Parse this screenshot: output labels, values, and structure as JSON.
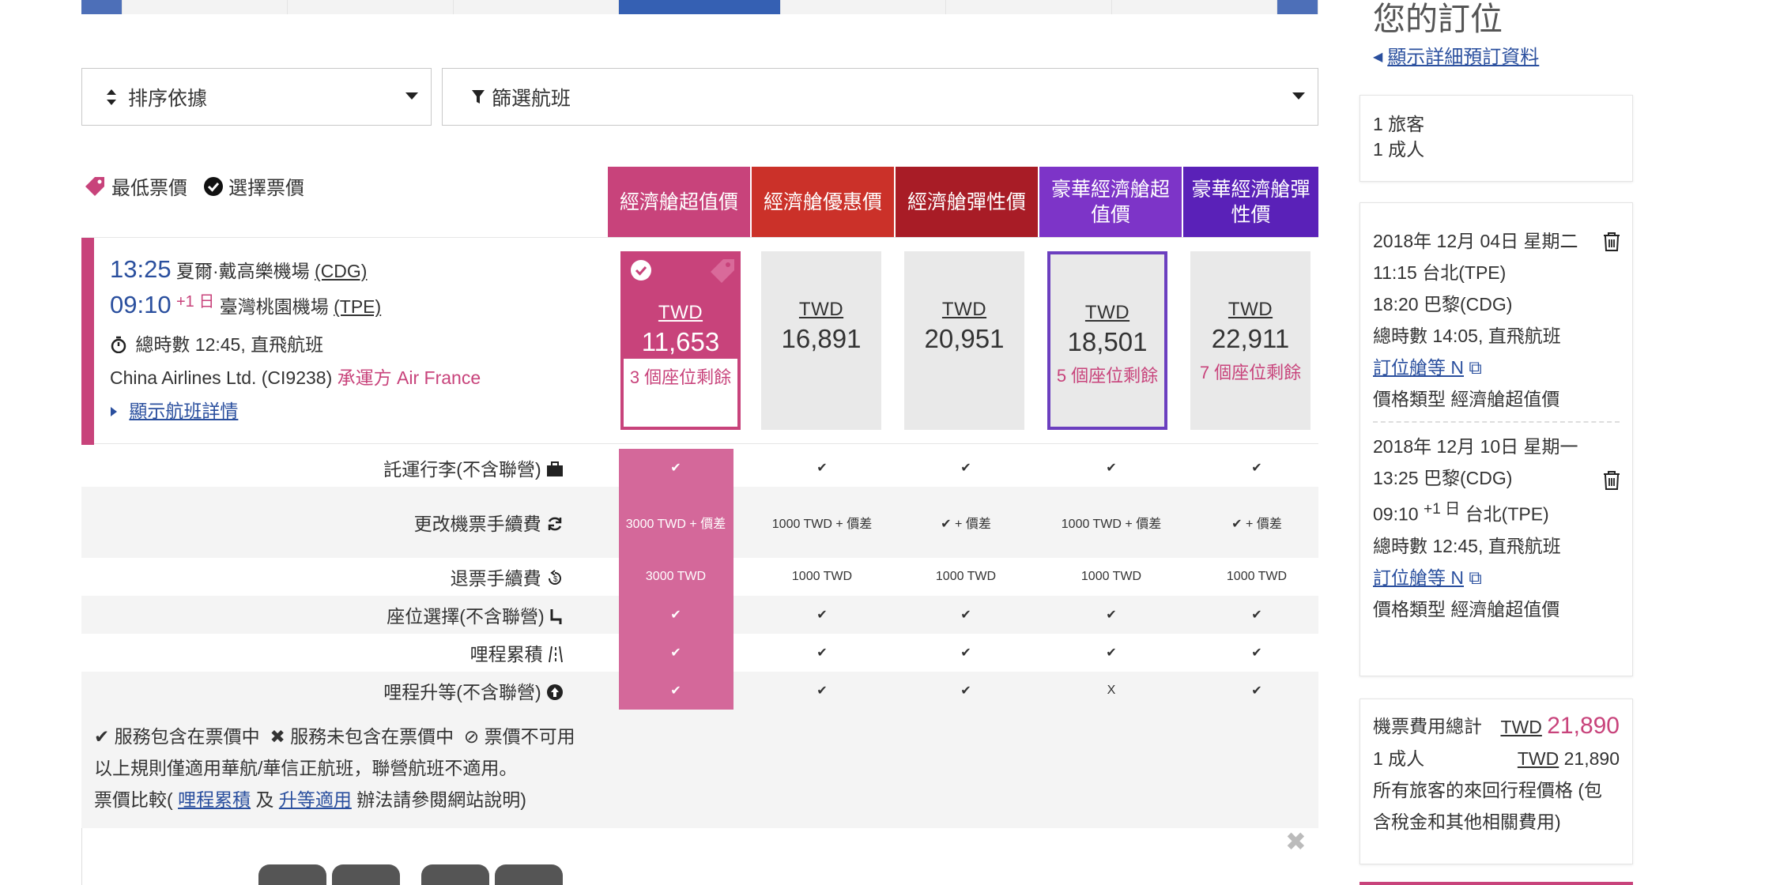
{
  "toolbar": {
    "sort_label": "排序依據",
    "filter_label": "篩選航班"
  },
  "legend": {
    "lowest_fare": "最低票價",
    "selected_fare": "選擇票價"
  },
  "fare_headers": [
    {
      "label": "經濟艙超值價",
      "color": "#c8437b"
    },
    {
      "label": "經濟艙優惠價",
      "color": "#cb3129"
    },
    {
      "label": "經濟艙彈性價",
      "color": "#a81c26"
    },
    {
      "label": "豪華經濟艙超值價",
      "color": "#7d34c8"
    },
    {
      "label": "豪華經濟艙彈性價",
      "color": "#5a21b8"
    }
  ],
  "flight": {
    "depart_time": "13:25",
    "depart_airport": "夏爾·戴高樂機場",
    "depart_code": "(CDG)",
    "arrive_time": "09:10",
    "arrive_offset": "+1 日",
    "arrive_airport": "臺灣桃園機場",
    "arrive_code": "(TPE)",
    "duration": "總時數 12:45, 直飛航班",
    "carrier": "China Airlines Ltd. (CI9238)",
    "operated_by": "承運方 Air France",
    "details_link": "顯示航班詳情"
  },
  "fares": [
    {
      "currency": "TWD",
      "amount": "11,653",
      "seats": "3 個座位剩餘"
    },
    {
      "currency": "TWD",
      "amount": "16,891",
      "seats": ""
    },
    {
      "currency": "TWD",
      "amount": "20,951",
      "seats": ""
    },
    {
      "currency": "TWD",
      "amount": "18,501",
      "seats": "5 個座位剩餘"
    },
    {
      "currency": "TWD",
      "amount": "22,911",
      "seats": "7 個座位剩餘"
    }
  ],
  "features": [
    {
      "label": "託運行李(不含聯營)",
      "values": [
        "✔",
        "✔",
        "✔",
        "✔",
        "✔"
      ]
    },
    {
      "label": "更改機票手續費",
      "values": [
        "3000 TWD + 價差",
        "1000 TWD + 價差",
        "✔ + 價差",
        "1000 TWD + 價差",
        "✔ + 價差"
      ]
    },
    {
      "label": "退票手續費",
      "values": [
        "3000 TWD",
        "1000 TWD",
        "1000 TWD",
        "1000 TWD",
        "1000 TWD"
      ]
    },
    {
      "label": "座位選擇(不含聯營)",
      "values": [
        "✔",
        "✔",
        "✔",
        "✔",
        "✔"
      ]
    },
    {
      "label": "哩程累積",
      "values": [
        "✔",
        "✔",
        "✔",
        "✔",
        "✔"
      ]
    },
    {
      "label": "哩程升等(不含聯營)",
      "values": [
        "✔",
        "✔",
        "✔",
        "X",
        "✔"
      ]
    }
  ],
  "footnote": {
    "included": "服務包含在票價中",
    "not_included": "服務未包含在票價中",
    "unavailable": "票價不可用",
    "rule": "以上規則僅適用華航/華信正航班，聯營航班不適用。",
    "compare_prefix": "票價比較(",
    "miles_link": "哩程累積",
    "and": "及",
    "upgrade_link": "升等適用",
    "compare_suffix": "辦法請參閱網站說明)"
  },
  "booking": {
    "title": "您的訂位",
    "details_link": "顯示詳細預訂資料",
    "travelers": "1 旅客",
    "adults": "1 成人",
    "segments": [
      {
        "date": "2018年 12月 04日 星期二",
        "depart": "11:15 台北(TPE)",
        "arrive": "18:20 巴黎(CDG)",
        "arrive_offset": "",
        "duration": "總時數 14:05, 直飛航班",
        "class_link": "訂位艙等 N",
        "fare_type": "價格類型 經濟艙超值價"
      },
      {
        "date": "2018年 12月 10日 星期一",
        "depart": "13:25 巴黎(CDG)",
        "arrive": "09:10",
        "arrive_offset": "+1 日",
        "arrive_city": "台北(TPE)",
        "duration": "總時數 12:45, 直飛航班",
        "class_link": "訂位艙等 N",
        "fare_type": "價格類型 經濟艙超值價"
      }
    ],
    "total_label": "機票費用總計",
    "total_currency": "TWD",
    "total_amount": "21,890",
    "adult_label": "1 成人",
    "adult_currency": "TWD",
    "adult_amount": "21,890",
    "note": "所有旅客的來回行程價格 (包含稅金和其他相關費用)"
  }
}
